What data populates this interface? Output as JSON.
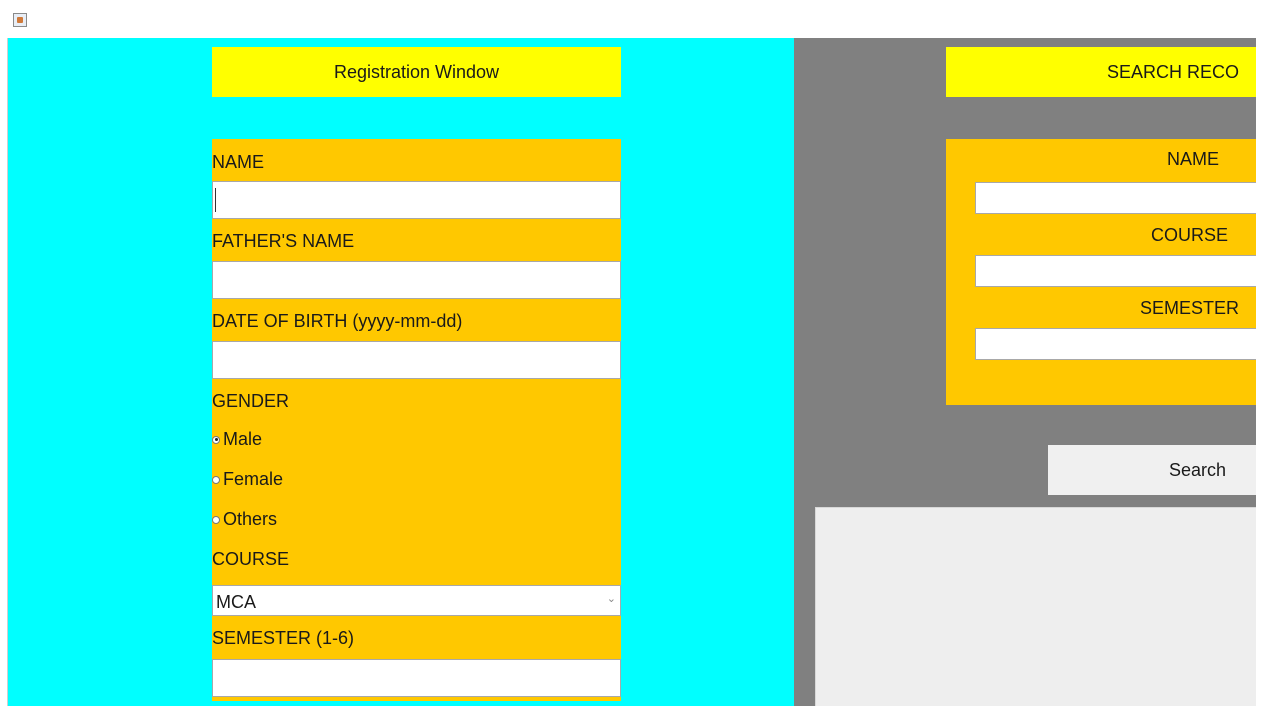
{
  "registration": {
    "title": "Registration Window",
    "name_label": "NAME",
    "name_value": "",
    "father_label": "FATHER'S NAME",
    "father_value": "",
    "dob_label": "DATE OF BIRTH (yyyy-mm-dd)",
    "dob_value": "",
    "gender_label": "GENDER",
    "gender_options": [
      "Male",
      "Female",
      "Others"
    ],
    "gender_selected": "Male",
    "course_label": "COURSE",
    "course_value": "MCA",
    "semester_label": "SEMESTER (1-6)",
    "semester_value": ""
  },
  "search": {
    "title": "SEARCH RECO",
    "name_label": "NAME",
    "course_label": "COURSE",
    "semester_label": "SEMESTER",
    "button_label": "Search"
  },
  "colors": {
    "left_background": "#00ffff",
    "right_background": "#808080",
    "title_banner": "#ffff00",
    "form_panel": "#ffc800"
  },
  "icons": {
    "app": "java-app-icon",
    "dropdown": "chevron-down-icon"
  }
}
